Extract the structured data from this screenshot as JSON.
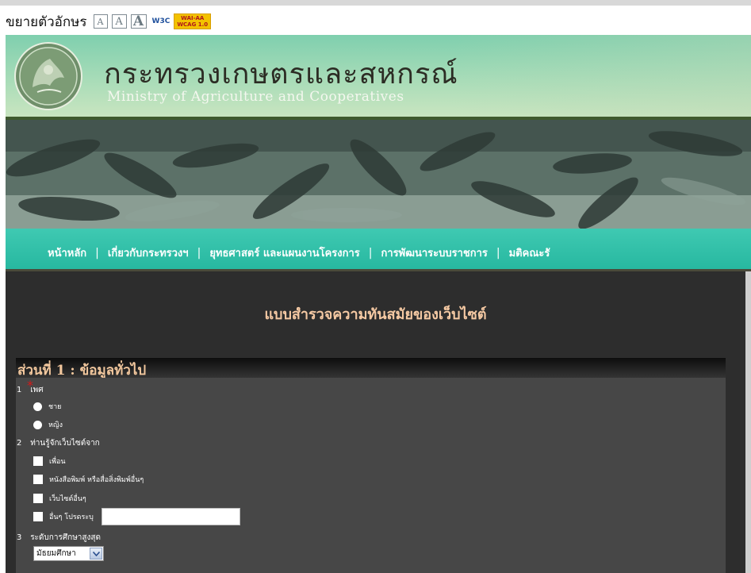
{
  "accessibility": {
    "label": "ขยายตัวอักษร",
    "font_buttons": [
      "A",
      "A",
      "A"
    ],
    "w3c_badge": "W3C",
    "wai_badge_line1": "WAI-AA",
    "wai_badge_line2": "WCAG 1.0"
  },
  "header": {
    "ministry_thai": "กระทรวงเกษตรและสหกรณ์",
    "ministry_english": "Ministry of Agriculture and Cooperatives"
  },
  "nav": {
    "items": [
      "หน้าหลัก",
      "เกี่ยวกับกระทรวงฯ",
      "ยุทธศาสตร์ และแผนงานโครงการ",
      "การพัฒนาระบบราชการ",
      "มติคณะรั"
    ]
  },
  "survey": {
    "title": "แบบสำรวจความทันสมัยของเว็บไซต์",
    "section_title": "ส่วนที่ 1 : ข้อมูลทั่วไป",
    "questions": [
      {
        "number": "1",
        "label": "เพศ",
        "required_mark": "*",
        "options": [
          "ชาย",
          "หญิง"
        ]
      },
      {
        "number": "2",
        "label": "ท่านรู้จักเว็บไซต์จาก",
        "options": [
          "เพื่อน",
          "หนังสือพิมพ์ หรือสื่อสิ่งพิมพ์อื่นๆ",
          "เว็บไซต์อื่นๆ",
          "อื่นๆ โปรดระบุ"
        ],
        "other_value": ""
      },
      {
        "number": "3",
        "label": "ระดับการศึกษาสูงสุด",
        "selected": "มัธยมศึกษา"
      }
    ]
  },
  "colors": {
    "nav_bg": "#2fc0a8",
    "content_bg": "#2d2d2d",
    "form_bg": "#474747",
    "heading_text": "#f5c9a3",
    "required": "#d41919"
  }
}
